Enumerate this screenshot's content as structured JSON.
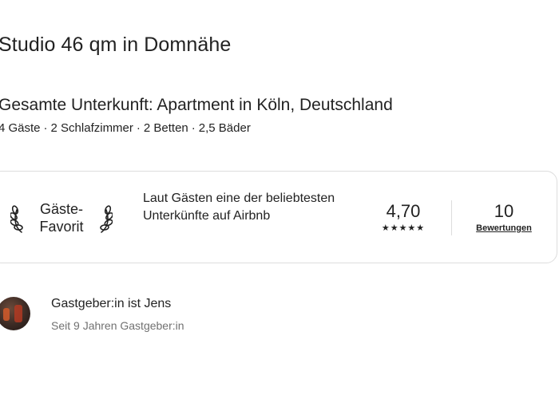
{
  "listing": {
    "title": "Studio 46 qm in Domnähe",
    "subtitle": "Gesamte Unterkunft: Apartment in Köln, Deutschland",
    "details": [
      "4 Gäste",
      "2 Schlafzimmer",
      "2 Betten",
      "2,5 Bäder"
    ],
    "details_separator": "·"
  },
  "guest_favorite": {
    "badge_line1": "Gäste-",
    "badge_line2": "Favorit",
    "description": "Laut Gästen eine der beliebtesten Unterkünfte auf Airbnb",
    "rating": "4,70",
    "stars": "★★★★★",
    "review_count": "10",
    "reviews_label": "Bewertungen"
  },
  "host": {
    "name_line": "Gastgeber:in ist Jens",
    "since": "Seit 9 Jahren Gastgeber:in"
  },
  "colors": {
    "text_primary": "#222222",
    "text_secondary": "#717171",
    "border": "#dddddd"
  }
}
